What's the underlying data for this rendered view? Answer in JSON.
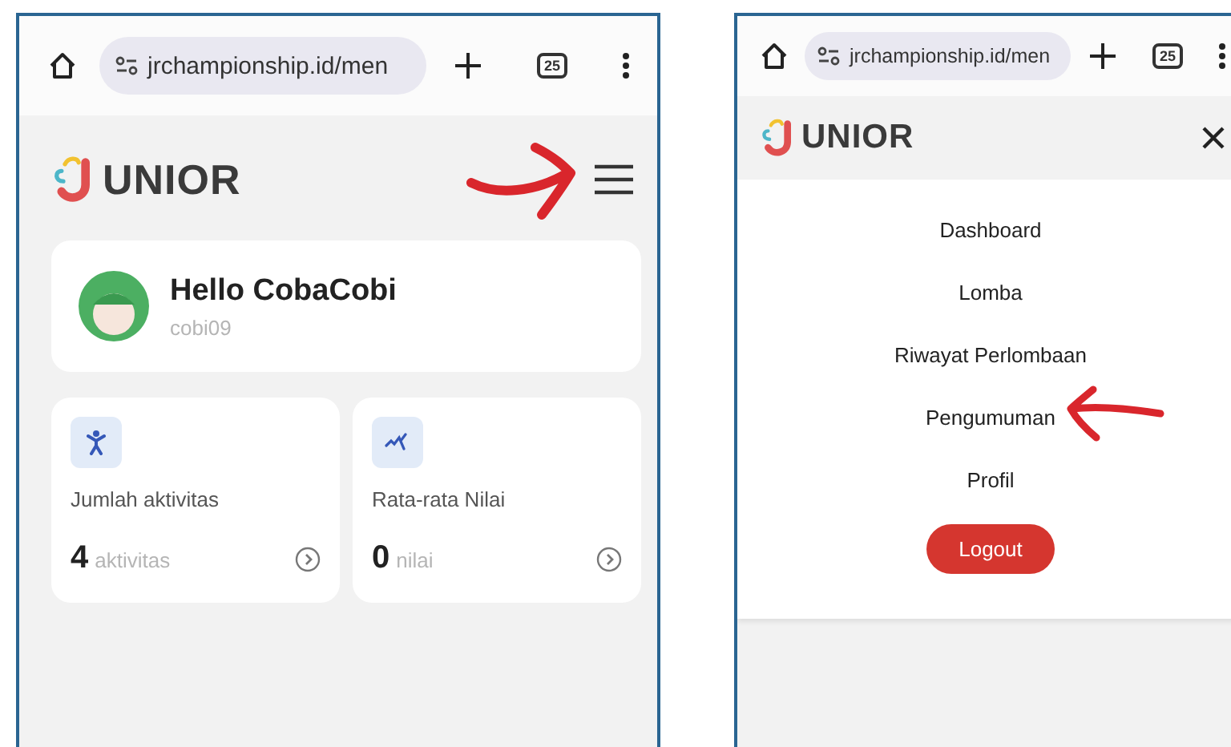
{
  "phones": [
    {
      "kind": "dashboard",
      "browser": {
        "url": "jrchampionship.id/men",
        "tab_count": "25"
      },
      "header": {
        "logo_text": "UNIOR",
        "kind": "menu",
        "marked": true
      },
      "profile": {
        "name": "Hello CobaCobi",
        "username": "cobi09"
      },
      "stats": [
        {
          "kind": "person",
          "label": "Jumlah aktivitas",
          "value": "4",
          "unit": "aktivitas"
        },
        {
          "kind": "chart",
          "label": "Rata-rata Nilai",
          "value": "0",
          "unit": "nilai"
        }
      ]
    },
    {
      "kind": "menu",
      "browser": {
        "url": "jrchampionship.id/men",
        "tab_count": "25"
      },
      "header": {
        "logo_text": "UNIOR",
        "kind": "close",
        "marked": false
      },
      "menu_items": [
        {
          "label": "Dashboard",
          "marked": false
        },
        {
          "label": "Lomba",
          "marked": false
        },
        {
          "label": "Riwayat Perlombaan",
          "marked": false
        },
        {
          "label": "Pengumuman",
          "marked": true
        },
        {
          "label": "Profil",
          "marked": false
        }
      ],
      "logout": "Logout"
    }
  ]
}
